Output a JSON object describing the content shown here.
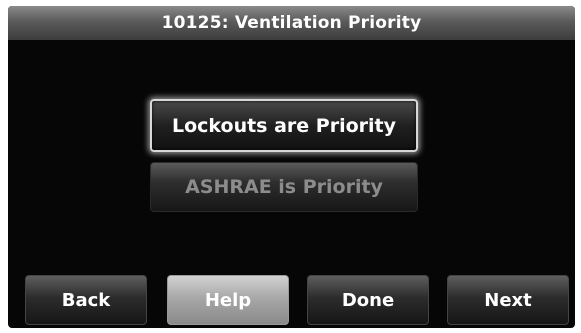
{
  "title": "10125: Ventilation Priority",
  "options": {
    "lockouts": "Lockouts are Priority",
    "ashrae": "ASHRAE is Priority"
  },
  "nav": {
    "back": "Back",
    "help": "Help",
    "done": "Done",
    "next": "Next"
  }
}
